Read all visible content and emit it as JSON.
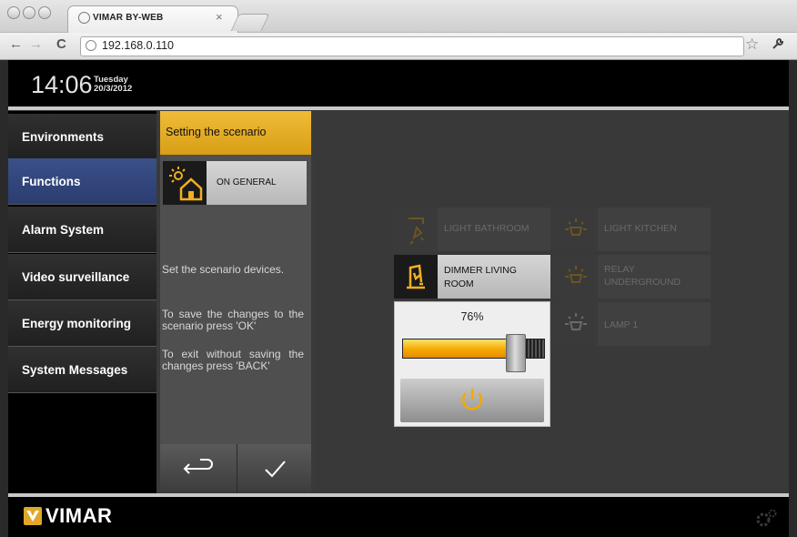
{
  "browser": {
    "tab_title": "VIMAR BY-WEB",
    "tab_close": "×",
    "url": "192.168.0.110",
    "back_icon": "←",
    "forward_icon": "→",
    "reload_icon": "C",
    "star_icon": "☆",
    "wrench_icon": "🔧"
  },
  "header": {
    "time": "14:06",
    "day_name": "Tuesday",
    "date": "20/3/2012"
  },
  "sidebar": {
    "items": [
      {
        "label": "Environments",
        "active": false
      },
      {
        "label": "Functions",
        "active": true
      },
      {
        "label": "Alarm System",
        "active": false
      },
      {
        "label": "Video surveillance",
        "active": false
      },
      {
        "label": "Energy monitoring",
        "active": false
      },
      {
        "label": "System Messages",
        "active": false
      }
    ]
  },
  "scenario": {
    "title": "Setting the scenario",
    "device_label": "ON GENERAL",
    "info": [
      "Set the scenario devices.",
      "To save the changes to the scenario press 'OK'",
      "To exit without saving the changes press 'BACK'"
    ]
  },
  "devices": [
    {
      "label": "LIGHT BATHROOM",
      "icon": "light-bathroom-icon",
      "active": false
    },
    {
      "label": "LIGHT KITCHEN",
      "icon": "bulb-icon",
      "active": false
    },
    {
      "label": "DIMMER LIVING ROOM",
      "icon": "dimmer-icon",
      "active": true
    },
    {
      "label": "RELAY UNDERGROUND",
      "icon": "bulb-icon",
      "active": false
    },
    {
      "label": "LAMP 1",
      "icon": "bulb-icon",
      "active": false
    }
  ],
  "dimmer": {
    "percent_label": "76%",
    "value": 0.76
  },
  "footer": {
    "brand": "VIMAR"
  },
  "colors": {
    "accent": "#e8a81c",
    "active_nav": "#34497e"
  }
}
